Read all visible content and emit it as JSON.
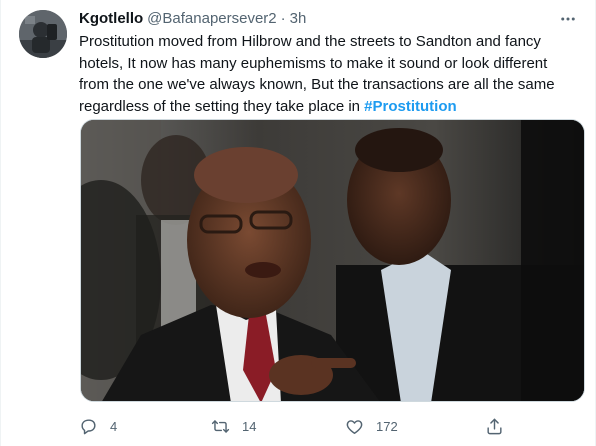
{
  "tweet": {
    "display_name": "Kgotlello",
    "handle": "@Bafanapersever2",
    "separator": "·",
    "time": "3h",
    "text_part1": "Prostitution moved from Hilbrow and the streets to Sandton and fancy hotels, It now has many euphemisms to make it sound or look different from the one we've always known, But the transactions are all the same regardless of the setting they take place in ",
    "hashtag": "#Prostitution",
    "media_description": "photo"
  },
  "actions": {
    "reply_count": "4",
    "retweet_count": "14",
    "like_count": "172",
    "share_label": ""
  },
  "colors": {
    "accent": "#1d9bf0",
    "secondary_text": "#536471",
    "primary_text": "#0f1419",
    "border": "#cfd9de"
  },
  "icons": {
    "more": "more-horizontal-icon",
    "reply": "reply-icon",
    "retweet": "retweet-icon",
    "like": "heart-icon",
    "share": "share-icon"
  }
}
